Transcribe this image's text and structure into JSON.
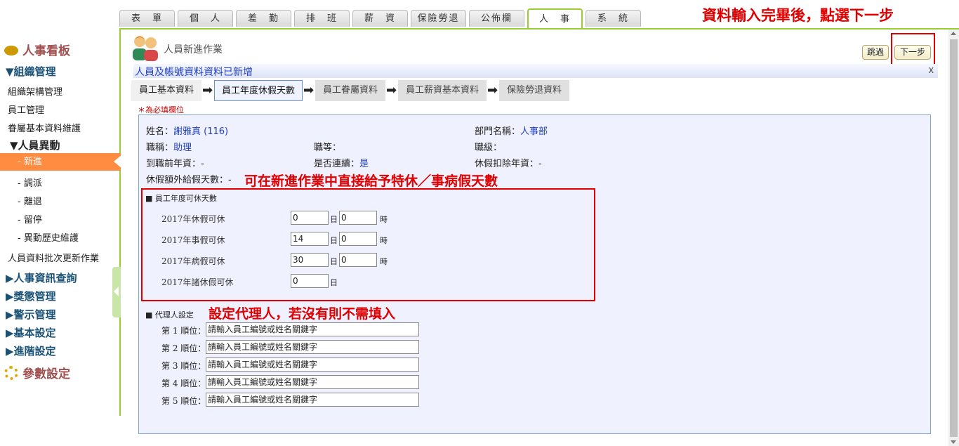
{
  "topnav": {
    "tabs": [
      "表　單",
      "個　人",
      "差　勤",
      "排　班",
      "薪　資",
      "保險勞退",
      "公佈欄",
      "人　事",
      "系　統"
    ],
    "active_index": 7
  },
  "annotations": {
    "top": "資料輸入完畢後，點選下一步",
    "leave": "可在新進作業中直接給予特休／事病假天數",
    "agent": "設定代理人，若沒有則不需填入"
  },
  "sidebar": {
    "title": "人事看板",
    "org_head": "▼組織管理",
    "org_items": [
      "組織架構管理",
      "員工管理",
      "眷屬基本資料維護"
    ],
    "change_head": "▼人員異動",
    "change_items": [
      "- 新進",
      "- 調派",
      "- 離退",
      "- 留停",
      "- 異動歷史維護"
    ],
    "batch_item": "人員資料批次更新作業",
    "sections": [
      "▶人事資訊查詢",
      "▶獎懲管理",
      "▶警示管理",
      "▶基本設定",
      "▶進階設定"
    ],
    "param": "參數設定"
  },
  "page": {
    "title": "人員新進作業",
    "skip_label": "跳過",
    "next_label": "下一步",
    "message": "人員及帳號資料資料已新增",
    "close_x": "X",
    "required_note": "＊為必填欄位"
  },
  "steps": [
    "員工基本資料",
    "員工年度休假天數",
    "員工眷屬資料",
    "員工薪資基本資料",
    "保險勞退資料"
  ],
  "employee": {
    "name_label": "姓名：",
    "name_value": "謝雅真",
    "name_id": "(116)",
    "dept_label": "部門名稱：",
    "dept_value": "人事部",
    "title_label": "職稱：",
    "title_value": "助理",
    "grade_label": "職等：",
    "level_label": "職級：",
    "prior_label": "到職前年資：-",
    "continuous_label": "是否連續：",
    "continuous_value": "是",
    "deduct_label": "休假扣除年資：-",
    "extra_label": "休假額外給假天數：-"
  },
  "leave": {
    "section_title": "■ 員工年度可休天數",
    "rows": [
      {
        "label": "2017年休假可休",
        "days": "0",
        "hours": "0"
      },
      {
        "label": "2017年事假可休",
        "days": "14",
        "hours": "0"
      },
      {
        "label": "2017年病假可休",
        "days": "30",
        "hours": "0"
      },
      {
        "label": "2017年諸休假可休",
        "days": "0",
        "hours": null
      }
    ],
    "day_unit": "日",
    "hour_unit": "時"
  },
  "agents": {
    "section_title": "■ 代理人設定",
    "rows": [
      "第 1 順位：",
      "第 2 順位：",
      "第 3 順位：",
      "第 4 順位：",
      "第 5 順位："
    ],
    "placeholder": "請輸入員工編號或姓名關鍵字"
  }
}
